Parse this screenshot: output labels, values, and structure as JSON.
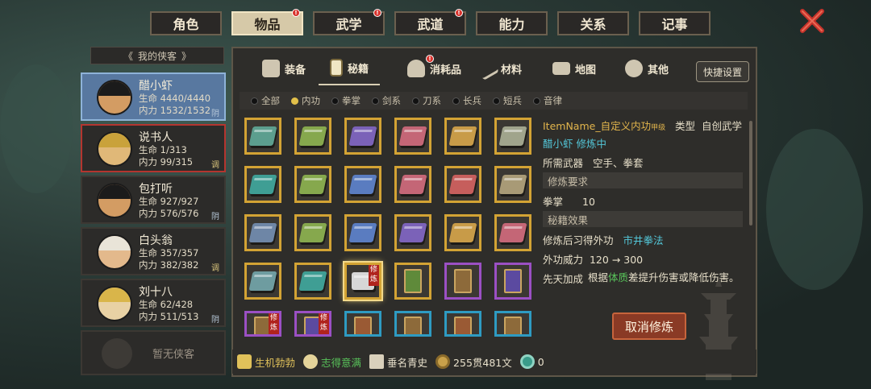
{
  "top_tabs": [
    {
      "label": "角色",
      "active": false,
      "dot": false
    },
    {
      "label": "物品",
      "active": true,
      "dot": true
    },
    {
      "label": "武学",
      "active": false,
      "dot": true
    },
    {
      "label": "武道",
      "active": false,
      "dot": true
    },
    {
      "label": "能力",
      "active": false,
      "dot": false
    },
    {
      "label": "关系",
      "active": false,
      "dot": false
    },
    {
      "label": "记事",
      "active": false,
      "dot": false
    }
  ],
  "sidebar": {
    "header": "我的侠客",
    "characters": [
      {
        "name": "醋小虾",
        "hp": "生命 4440/4440",
        "mp": "内力 1532/1532",
        "tag": "阴"
      },
      {
        "name": "说书人",
        "hp": "生命 1/313",
        "mp": "内力 99/315",
        "tag": "调"
      },
      {
        "name": "包打听",
        "hp": "生命 927/927",
        "mp": "内力 576/576",
        "tag": "阴"
      },
      {
        "name": "白头翁",
        "hp": "生命 357/357",
        "mp": "内力 382/382",
        "tag": "调"
      },
      {
        "name": "刘十八",
        "hp": "生命 62/428",
        "mp": "内力 511/513",
        "tag": "阴"
      }
    ],
    "empty_slot": "暂无侠客"
  },
  "sub_tabs": {
    "equip": "装备",
    "manual": "秘籍",
    "consumable": "消耗品",
    "material": "材料",
    "map": "地图",
    "other": "其他",
    "quick_settings": "快捷设置"
  },
  "filters": [
    "全部",
    "内功",
    "拳掌",
    "剑系",
    "刀系",
    "长兵",
    "短兵",
    "音律"
  ],
  "selected_filter_index": 1,
  "grid_badge": "修炼",
  "detail": {
    "item_name": "ItemName_自定义内功",
    "grade": "甲级",
    "type_label": "类型",
    "type_value": "自创武学",
    "practicing": "醋小虾 修炼中",
    "weapon_label": "所需武器",
    "weapon_value": "空手、拳套",
    "req_header": "修炼要求",
    "req_skill": "拳掌",
    "req_value": "10",
    "effect_header": "秘籍效果",
    "learn_label": "修炼后习得外功",
    "learn_value": "市井拳法",
    "power_label": "外功威力",
    "power_value": "120 → 300",
    "innate_label": "先天加成",
    "innate_pre": "根据",
    "innate_key": "体质",
    "innate_post": "差提升伤害或降低伤害。",
    "cancel_button": "取消修炼"
  },
  "bottom": {
    "status1": "生机勃勃",
    "status2": "志得意满",
    "status3": "垂名青史",
    "money": "255贯481文",
    "coin": "0"
  },
  "colors": {
    "gold_border": "#d3a334",
    "purple_border": "#9b50c4",
    "cyan_border": "#2e9bc2",
    "accent_cyan": "#53c6d8",
    "accent_green": "#58c35a"
  }
}
